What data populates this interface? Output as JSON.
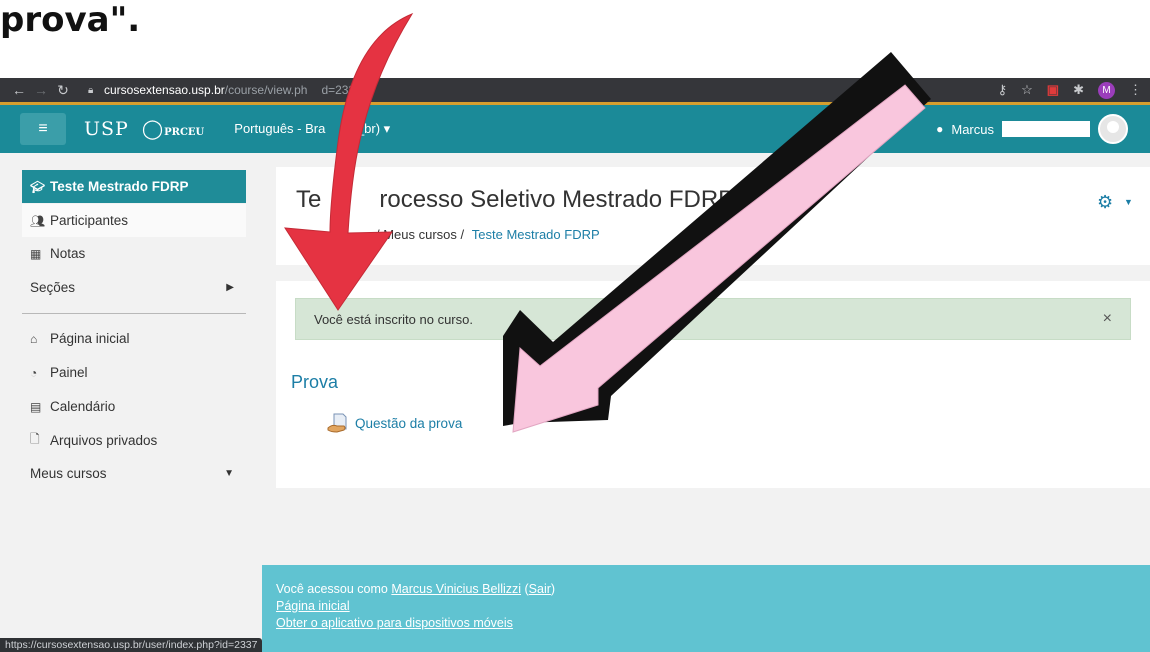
{
  "caption": {
    "text": "prova\"."
  },
  "browser": {
    "url_host": "cursosextensao.usp.br",
    "url_path": "/course/view.ph",
    "url_tail": "d=2337",
    "profile_initial": "M"
  },
  "navbar": {
    "logo_text": "USP",
    "logo_sub": "PRCEU",
    "language": "Português - Bra",
    "language_tail": "_br) ▾",
    "user_name": "Marcus"
  },
  "sidebar": {
    "items": [
      {
        "label": "Teste Mestrado FDRP",
        "icon": "graduation-cap-icon"
      },
      {
        "label": "Participantes",
        "icon": "users-icon"
      },
      {
        "label": "Notas",
        "icon": "table-icon"
      },
      {
        "label": "Seções",
        "icon": "caret-right-icon"
      },
      {
        "label": "Página inicial",
        "icon": "home-icon"
      },
      {
        "label": "Painel",
        "icon": "dashboard-icon"
      },
      {
        "label": "Calendário",
        "icon": "calendar-icon"
      },
      {
        "label": "Arquivos privados",
        "icon": "file-icon"
      },
      {
        "label": "Meus cursos",
        "icon": "caret-down-icon"
      }
    ]
  },
  "course": {
    "title_start": "Te",
    "title_end": "rocesso Seletivo Mestrado FDRP",
    "breadcrumb_mid": "/ Meus cursos /",
    "breadcrumb_current": "Teste Mestrado FDRP"
  },
  "alert": {
    "text": "Você está inscrito no curso.",
    "close": "×"
  },
  "section": {
    "title": "Prova",
    "activity": "Questão da prova"
  },
  "footer": {
    "logged_prefix": "Você acessou como",
    "user_full": "Marcus Vinicius Bellizzi",
    "logout": "Sair",
    "home_link": "Página inicial",
    "app_link": "Obter o aplicativo para dispositivos móveis"
  },
  "status_url": "https://cursosextensao.usp.br/user/index.php?id=2337",
  "annotation_colors": {
    "red_arrow": "#e53342",
    "pink_arrow": "#f9c6dd",
    "outline": "#111111"
  }
}
